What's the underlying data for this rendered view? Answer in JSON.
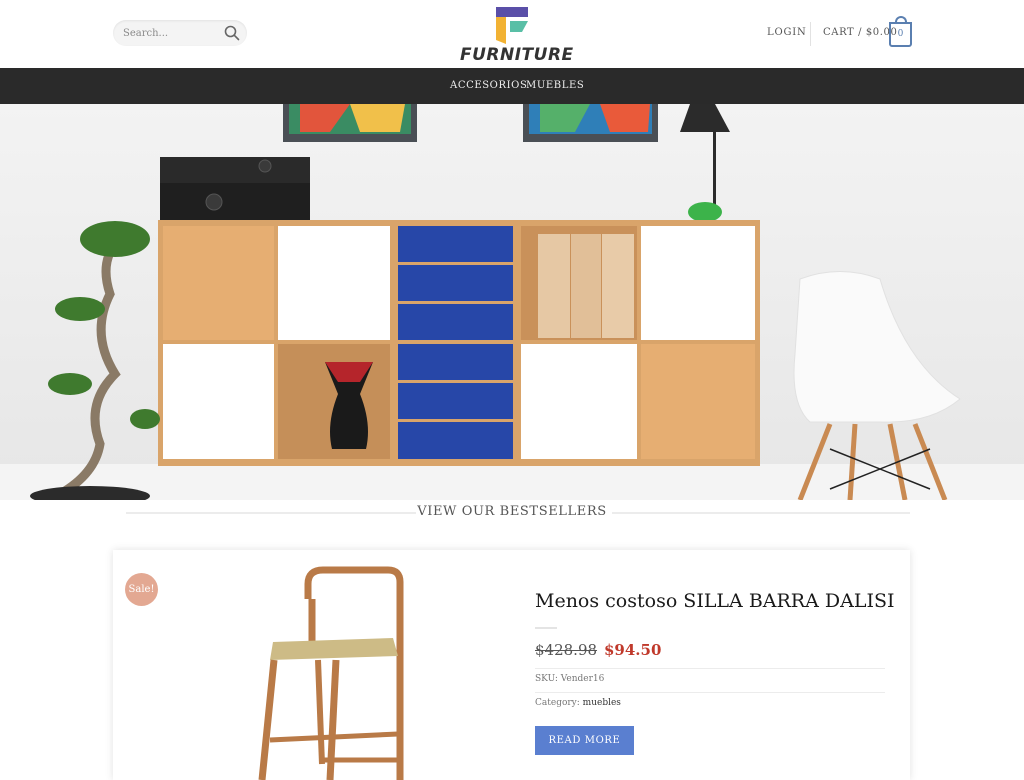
{
  "header": {
    "search_placeholder": "Search...",
    "logo_text": "FURNITURE",
    "login_label": "LOGIN",
    "cart_label": "CART / $0.00",
    "cart_count": "0"
  },
  "nav": {
    "items": [
      {
        "label": "ACCESORIOS"
      },
      {
        "label": "MUEBLES"
      }
    ]
  },
  "section": {
    "title": "VIEW OUR BESTSELLERS"
  },
  "product": {
    "badge": "Sale!",
    "title": "Menos costoso SILLA BARRA DALISI",
    "old_price": "$428.98",
    "new_price": "$94.50",
    "sku_label": "SKU: Vender16",
    "category_label": "Category:",
    "category_value": "muebles",
    "button_label": "READ MORE"
  },
  "colors": {
    "accent": "#5a7fd0",
    "sale": "#e3a892",
    "price": "#c0392b",
    "nav_bg": "#2a2a2a"
  }
}
